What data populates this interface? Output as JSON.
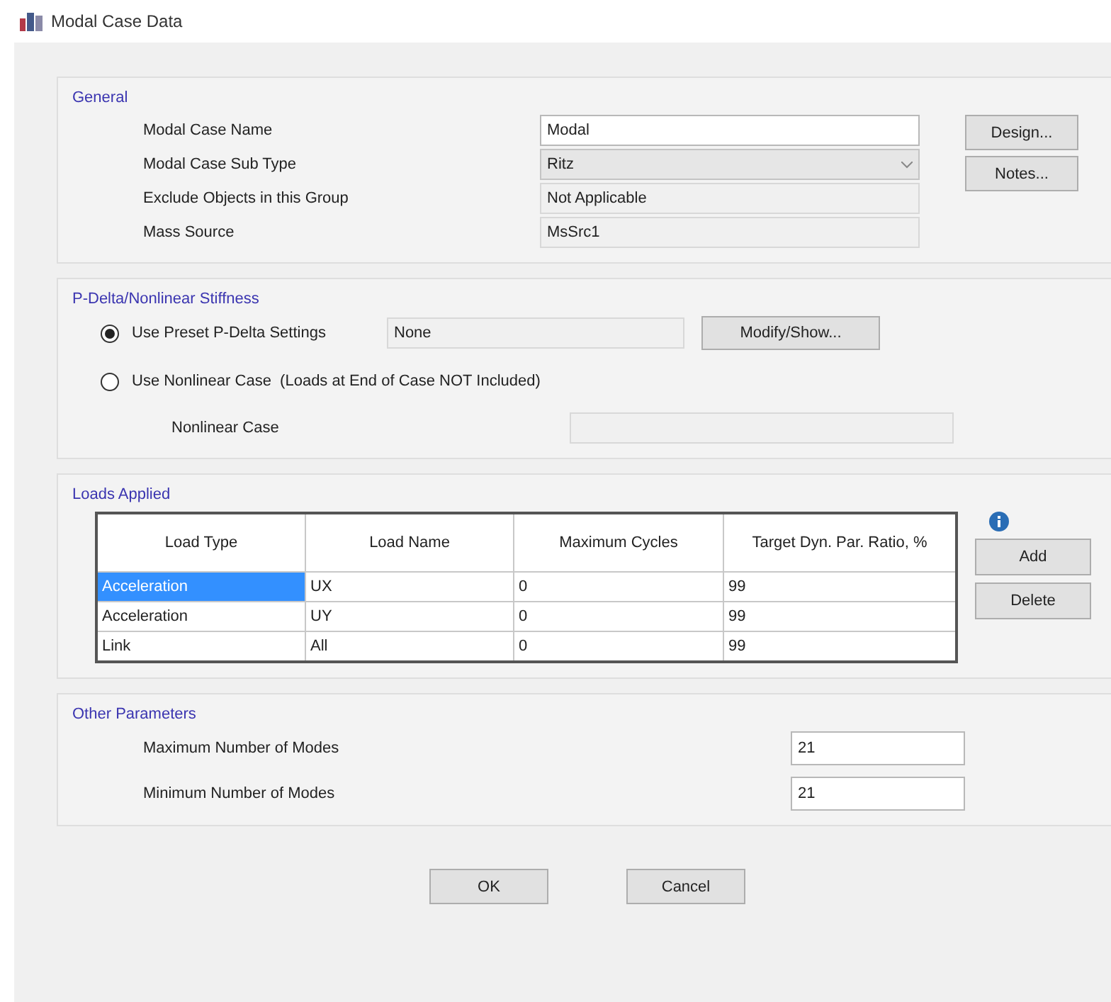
{
  "window": {
    "title": "Modal Case Data"
  },
  "general": {
    "title": "General",
    "fields": [
      {
        "label": "Modal Case Name",
        "value": "Modal",
        "kind": "text"
      },
      {
        "label": "Modal Case Sub Type",
        "value": "Ritz",
        "kind": "dropdown"
      },
      {
        "label": "Exclude Objects in this Group",
        "value": "Not Applicable",
        "kind": "readonly"
      },
      {
        "label": "Mass Source",
        "value": "MsSrc1",
        "kind": "readonly"
      }
    ],
    "buttons": [
      "Design...",
      "Notes..."
    ]
  },
  "pdelta": {
    "title": "P-Delta/Nonlinear Stiffness",
    "options": [
      {
        "label": "Use Preset P-Delta Settings",
        "selected": true,
        "value": "None",
        "button": "Modify/Show..."
      },
      {
        "label": "Use Nonlinear Case  (Loads at End of Case NOT Included)",
        "selected": false
      }
    ],
    "nonlinear_case": {
      "label": "Nonlinear Case"
    }
  },
  "loads": {
    "title": "Loads Applied",
    "table": {
      "columns": [
        "Load Type",
        "Load Name",
        "Maximum Cycles",
        "Target Dyn. Par. Ratio, %"
      ],
      "rows": [
        {
          "cells": [
            "Acceleration",
            "UX",
            "0",
            "99"
          ],
          "selected": true
        },
        {
          "cells": [
            "Acceleration",
            "UY",
            "0",
            "99"
          ],
          "selected": false
        },
        {
          "cells": [
            "Link",
            "All",
            "0",
            "99"
          ],
          "selected": false
        }
      ]
    },
    "buttons": [
      "Add",
      "Delete"
    ]
  },
  "other": {
    "title": "Other Parameters",
    "fields": [
      {
        "label": "Maximum Number of Modes",
        "value": "21"
      },
      {
        "label": "Minimum Number of Modes",
        "value": "21"
      }
    ]
  },
  "buttons": [
    "OK",
    "Cancel"
  ]
}
